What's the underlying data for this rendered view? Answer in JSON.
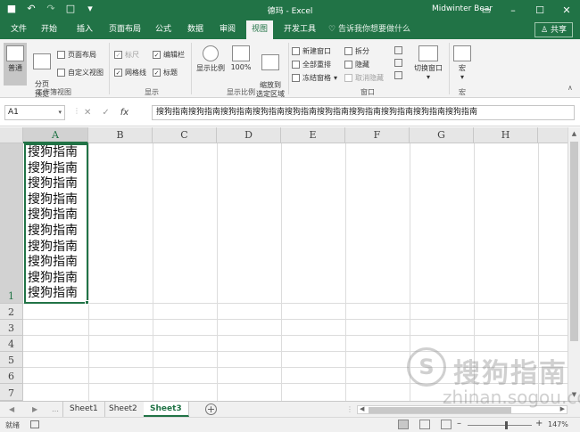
{
  "titlebar": {
    "doc_title": "德玛 - Excel",
    "user": "Midwinter Bear",
    "qat_icons": [
      "save-icon",
      "undo-icon",
      "redo-icon",
      "new-file-icon",
      "customize-icon"
    ]
  },
  "menu": {
    "tabs": [
      "文件",
      "开始",
      "插入",
      "页面布局",
      "公式",
      "数据",
      "审阅",
      "视图",
      "开发工具"
    ],
    "active_tab": "视图",
    "tell_me": "告诉我你想要做什么",
    "share": "共享"
  },
  "ribbon": {
    "workbook_views": {
      "normal": "普通",
      "page_break": "分页\n预览",
      "page_layout": "页面布局",
      "custom_views": "自定义视图",
      "label": "工作簿视图"
    },
    "show": {
      "ruler": "标尺",
      "gridlines": "网格线",
      "formula_bar": "编辑栏",
      "headings": "标题",
      "label": "显示"
    },
    "zoom": {
      "zoom": "显示比例",
      "hundred": "100%",
      "zoom_selection": "缩放到\n选定区域",
      "label": "显示比例"
    },
    "window": {
      "new_window": "新建窗口",
      "arrange_all": "全部重排",
      "freeze_panes": "冻结窗格",
      "split": "拆分",
      "hide": "隐藏",
      "unhide": "取消隐藏",
      "switch_windows": "切换窗口",
      "label": "窗口"
    },
    "macros": {
      "macro": "宏",
      "label": "宏"
    }
  },
  "formula_bar": {
    "name_box": "A1",
    "formula": "搜狗指南搜狗指南搜狗指南搜狗指南搜狗指南搜狗指南搜狗指南搜狗指南搜狗指南搜狗指南"
  },
  "grid": {
    "columns": [
      "A",
      "B",
      "C",
      "D",
      "E",
      "F",
      "G",
      "H"
    ],
    "rows": [
      "1",
      "2",
      "3",
      "4",
      "5",
      "6",
      "7"
    ],
    "a1_lines": [
      "搜狗指南",
      "搜狗指南",
      "搜狗指南",
      "搜狗指南",
      "搜狗指南",
      "搜狗指南",
      "搜狗指南",
      "搜狗指南",
      "搜狗指南",
      "搜狗指南"
    ]
  },
  "sheets": {
    "tabs": [
      "Sheet1",
      "Sheet2",
      "Sheet3"
    ],
    "active": "Sheet3"
  },
  "status": {
    "ready": "就绪",
    "zoom": "147%"
  },
  "watermark": {
    "logo_letter": "S",
    "text": "搜狗指南",
    "url": "zhinan.sogou.com"
  }
}
